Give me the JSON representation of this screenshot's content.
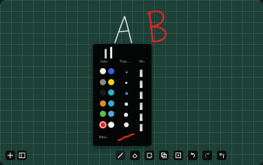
{
  "pen_panel": {
    "columns": {
      "color": "Color",
      "thickness": "Thick...",
      "pen": "Pen"
    },
    "colors": [
      "#f2f2f2",
      "#2f63e0",
      "#8a8a8a",
      "#e8d31f",
      "#1a1a1a",
      "#22b6c6",
      "#e88a2a",
      "#2fb2c9",
      "#5cc04a",
      "#4ba7e0",
      "#e53935",
      "#f2f2f2"
    ],
    "selected_color": "#d8262a",
    "preview_label": "Previ..."
  },
  "toolbar": {
    "left_icons": [
      "plus-icon",
      "sidebar-icon"
    ],
    "bottom_icons": [
      "pen-icon",
      "eraser-icon",
      "shape-icon",
      "copy-icon",
      "add-page-icon",
      "undo-icon",
      "redo-icon",
      "more-icon"
    ],
    "active_tool": "pen-icon"
  },
  "canvas": {
    "handwritten": [
      "A",
      "B"
    ],
    "stroke_color_a": "#e6e6e6",
    "stroke_color_b": "#d8262a"
  }
}
